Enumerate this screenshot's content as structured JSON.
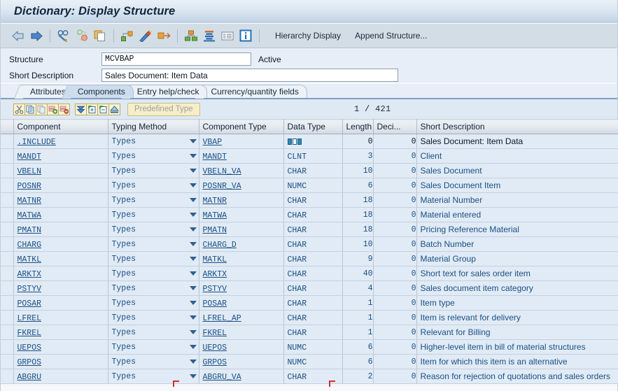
{
  "window": {
    "title": "Dictionary: Display Structure"
  },
  "toolbar": {
    "buttons": [
      {
        "name": "back-arrow-icon",
        "label": "Back"
      },
      {
        "name": "forward-arrow-icon",
        "label": "Forward"
      },
      {
        "name": "display-change-icon",
        "label": "Display <-> Change"
      },
      {
        "name": "refresh-icon",
        "label": "Other structure"
      },
      {
        "name": "copy-structure-icon",
        "label": "Copy"
      },
      {
        "name": "where-used-icon",
        "label": "Where-Used List"
      },
      {
        "name": "generate-icon",
        "label": "Generate"
      },
      {
        "name": "expand-icon",
        "label": "Expand"
      },
      {
        "name": "hierarchy-icon",
        "label": "Hierarchy"
      },
      {
        "name": "stack-icon",
        "label": "Stack"
      },
      {
        "name": "list-icon",
        "label": "List"
      },
      {
        "name": "info-icon",
        "label": "Information"
      }
    ],
    "text_buttons": [
      "Hierarchy Display",
      "Append Structure..."
    ]
  },
  "form": {
    "structure_label": "Structure",
    "structure_value": "MCVBAP",
    "status": "Active",
    "short_description_label": "Short Description",
    "short_description_value": "Sales Document: Item Data"
  },
  "tabs": [
    {
      "label": "Attributes",
      "active": false
    },
    {
      "label": "Components",
      "active": true
    },
    {
      "label": "Entry help/check",
      "active": false
    },
    {
      "label": "Currency/quantity fields",
      "active": false
    }
  ],
  "grid_toolbar": {
    "buttons": [
      {
        "name": "cut-icon",
        "label": "Cut"
      },
      {
        "name": "copy-icon",
        "label": "Copy"
      },
      {
        "name": "paste-icon",
        "label": "Paste"
      },
      {
        "name": "insert-row-icon",
        "label": "Insert Row"
      },
      {
        "name": "delete-row-icon",
        "label": "Delete Row"
      },
      {
        "name": "srch-help-icon",
        "label": "Expand All"
      },
      {
        "name": "expand-include-icon",
        "label": "Expand Include"
      },
      {
        "name": "collapse-include-icon",
        "label": "Collapse Include"
      },
      {
        "name": "predecessor-icon",
        "label": "Up"
      }
    ],
    "predefined_type_label": "Predefined Type",
    "counter": "1 / 421"
  },
  "table": {
    "columns": [
      "Component",
      "Typing Method",
      "Component Type",
      "Data Type",
      "Length",
      "Deci...",
      "Short Description"
    ],
    "rows": [
      {
        "component": ".INCLUDE",
        "typing": "Types",
        "comp_type": "VBAP",
        "data_type": "",
        "data_type_icon": "structure-icon",
        "length": "0",
        "decimals": "0",
        "desc": "Sales Document: Item Data",
        "black": true
      },
      {
        "component": "MANDT",
        "typing": "Types",
        "comp_type": "MANDT",
        "data_type": "CLNT",
        "length": "3",
        "decimals": "0",
        "desc": "Client"
      },
      {
        "component": "VBELN",
        "typing": "Types",
        "comp_type": "VBELN_VA",
        "data_type": "CHAR",
        "length": "10",
        "decimals": "0",
        "desc": "Sales Document"
      },
      {
        "component": "POSNR",
        "typing": "Types",
        "comp_type": "POSNR_VA",
        "data_type": "NUMC",
        "length": "6",
        "decimals": "0",
        "desc": "Sales Document Item"
      },
      {
        "component": "MATNR",
        "typing": "Types",
        "comp_type": "MATNR",
        "data_type": "CHAR",
        "length": "18",
        "decimals": "0",
        "desc": "Material Number"
      },
      {
        "component": "MATWA",
        "typing": "Types",
        "comp_type": "MATWA",
        "data_type": "CHAR",
        "length": "18",
        "decimals": "0",
        "desc": "Material entered"
      },
      {
        "component": "PMATN",
        "typing": "Types",
        "comp_type": "PMATN",
        "data_type": "CHAR",
        "length": "18",
        "decimals": "0",
        "desc": "Pricing Reference Material"
      },
      {
        "component": "CHARG",
        "typing": "Types",
        "comp_type": "CHARG_D",
        "data_type": "CHAR",
        "length": "10",
        "decimals": "0",
        "desc": "Batch Number"
      },
      {
        "component": "MATKL",
        "typing": "Types",
        "comp_type": "MATKL",
        "data_type": "CHAR",
        "length": "9",
        "decimals": "0",
        "desc": "Material Group"
      },
      {
        "component": "ARKTX",
        "typing": "Types",
        "comp_type": "ARKTX",
        "data_type": "CHAR",
        "length": "40",
        "decimals": "0",
        "desc": "Short text for sales order item"
      },
      {
        "component": "PSTYV",
        "typing": "Types",
        "comp_type": "PSTYV",
        "data_type": "CHAR",
        "length": "4",
        "decimals": "0",
        "desc": "Sales document item category"
      },
      {
        "component": "POSAR",
        "typing": "Types",
        "comp_type": "POSAR",
        "data_type": "CHAR",
        "length": "1",
        "decimals": "0",
        "desc": "Item type"
      },
      {
        "component": "LFREL",
        "typing": "Types",
        "comp_type": "LFREL_AP",
        "data_type": "CHAR",
        "length": "1",
        "decimals": "0",
        "desc": "Item is relevant for delivery"
      },
      {
        "component": "FKREL",
        "typing": "Types",
        "comp_type": "FKREL",
        "data_type": "CHAR",
        "length": "1",
        "decimals": "0",
        "desc": "Relevant for Billing"
      },
      {
        "component": "UEPOS",
        "typing": "Types",
        "comp_type": "UEPOS",
        "data_type": "NUMC",
        "length": "6",
        "decimals": "0",
        "desc": "Higher-level item in bill of material structures"
      },
      {
        "component": "GRPOS",
        "typing": "Types",
        "comp_type": "GRPOS",
        "data_type": "NUMC",
        "length": "6",
        "decimals": "0",
        "desc": "Item for which this item is an alternative"
      },
      {
        "component": "ABGRU",
        "typing": "Types",
        "comp_type": "ABGRU_VA",
        "data_type": "CHAR",
        "length": "2",
        "decimals": "0",
        "desc": "Reason for rejection of quotations and sales orders",
        "partial": true
      }
    ]
  }
}
